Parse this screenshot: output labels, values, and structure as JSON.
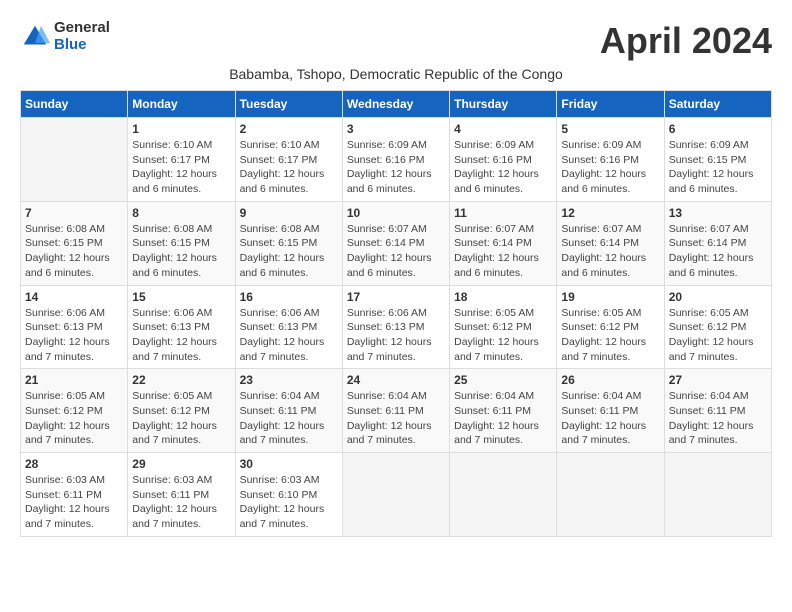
{
  "logo": {
    "general": "General",
    "blue": "Blue"
  },
  "header": {
    "title": "April 2024",
    "subtitle": "Babamba, Tshopo, Democratic Republic of the Congo"
  },
  "days_of_week": [
    "Sunday",
    "Monday",
    "Tuesday",
    "Wednesday",
    "Thursday",
    "Friday",
    "Saturday"
  ],
  "weeks": [
    [
      {
        "day": "",
        "info": ""
      },
      {
        "day": "1",
        "info": "Sunrise: 6:10 AM\nSunset: 6:17 PM\nDaylight: 12 hours\nand 6 minutes."
      },
      {
        "day": "2",
        "info": "Sunrise: 6:10 AM\nSunset: 6:17 PM\nDaylight: 12 hours\nand 6 minutes."
      },
      {
        "day": "3",
        "info": "Sunrise: 6:09 AM\nSunset: 6:16 PM\nDaylight: 12 hours\nand 6 minutes."
      },
      {
        "day": "4",
        "info": "Sunrise: 6:09 AM\nSunset: 6:16 PM\nDaylight: 12 hours\nand 6 minutes."
      },
      {
        "day": "5",
        "info": "Sunrise: 6:09 AM\nSunset: 6:16 PM\nDaylight: 12 hours\nand 6 minutes."
      },
      {
        "day": "6",
        "info": "Sunrise: 6:09 AM\nSunset: 6:15 PM\nDaylight: 12 hours\nand 6 minutes."
      }
    ],
    [
      {
        "day": "7",
        "info": "Sunrise: 6:08 AM\nSunset: 6:15 PM\nDaylight: 12 hours\nand 6 minutes."
      },
      {
        "day": "8",
        "info": "Sunrise: 6:08 AM\nSunset: 6:15 PM\nDaylight: 12 hours\nand 6 minutes."
      },
      {
        "day": "9",
        "info": "Sunrise: 6:08 AM\nSunset: 6:15 PM\nDaylight: 12 hours\nand 6 minutes."
      },
      {
        "day": "10",
        "info": "Sunrise: 6:07 AM\nSunset: 6:14 PM\nDaylight: 12 hours\nand 6 minutes."
      },
      {
        "day": "11",
        "info": "Sunrise: 6:07 AM\nSunset: 6:14 PM\nDaylight: 12 hours\nand 6 minutes."
      },
      {
        "day": "12",
        "info": "Sunrise: 6:07 AM\nSunset: 6:14 PM\nDaylight: 12 hours\nand 6 minutes."
      },
      {
        "day": "13",
        "info": "Sunrise: 6:07 AM\nSunset: 6:14 PM\nDaylight: 12 hours\nand 6 minutes."
      }
    ],
    [
      {
        "day": "14",
        "info": "Sunrise: 6:06 AM\nSunset: 6:13 PM\nDaylight: 12 hours\nand 7 minutes."
      },
      {
        "day": "15",
        "info": "Sunrise: 6:06 AM\nSunset: 6:13 PM\nDaylight: 12 hours\nand 7 minutes."
      },
      {
        "day": "16",
        "info": "Sunrise: 6:06 AM\nSunset: 6:13 PM\nDaylight: 12 hours\nand 7 minutes."
      },
      {
        "day": "17",
        "info": "Sunrise: 6:06 AM\nSunset: 6:13 PM\nDaylight: 12 hours\nand 7 minutes."
      },
      {
        "day": "18",
        "info": "Sunrise: 6:05 AM\nSunset: 6:12 PM\nDaylight: 12 hours\nand 7 minutes."
      },
      {
        "day": "19",
        "info": "Sunrise: 6:05 AM\nSunset: 6:12 PM\nDaylight: 12 hours\nand 7 minutes."
      },
      {
        "day": "20",
        "info": "Sunrise: 6:05 AM\nSunset: 6:12 PM\nDaylight: 12 hours\nand 7 minutes."
      }
    ],
    [
      {
        "day": "21",
        "info": "Sunrise: 6:05 AM\nSunset: 6:12 PM\nDaylight: 12 hours\nand 7 minutes."
      },
      {
        "day": "22",
        "info": "Sunrise: 6:05 AM\nSunset: 6:12 PM\nDaylight: 12 hours\nand 7 minutes."
      },
      {
        "day": "23",
        "info": "Sunrise: 6:04 AM\nSunset: 6:11 PM\nDaylight: 12 hours\nand 7 minutes."
      },
      {
        "day": "24",
        "info": "Sunrise: 6:04 AM\nSunset: 6:11 PM\nDaylight: 12 hours\nand 7 minutes."
      },
      {
        "day": "25",
        "info": "Sunrise: 6:04 AM\nSunset: 6:11 PM\nDaylight: 12 hours\nand 7 minutes."
      },
      {
        "day": "26",
        "info": "Sunrise: 6:04 AM\nSunset: 6:11 PM\nDaylight: 12 hours\nand 7 minutes."
      },
      {
        "day": "27",
        "info": "Sunrise: 6:04 AM\nSunset: 6:11 PM\nDaylight: 12 hours\nand 7 minutes."
      }
    ],
    [
      {
        "day": "28",
        "info": "Sunrise: 6:03 AM\nSunset: 6:11 PM\nDaylight: 12 hours\nand 7 minutes."
      },
      {
        "day": "29",
        "info": "Sunrise: 6:03 AM\nSunset: 6:11 PM\nDaylight: 12 hours\nand 7 minutes."
      },
      {
        "day": "30",
        "info": "Sunrise: 6:03 AM\nSunset: 6:10 PM\nDaylight: 12 hours\nand 7 minutes."
      },
      {
        "day": "",
        "info": ""
      },
      {
        "day": "",
        "info": ""
      },
      {
        "day": "",
        "info": ""
      },
      {
        "day": "",
        "info": ""
      }
    ]
  ]
}
